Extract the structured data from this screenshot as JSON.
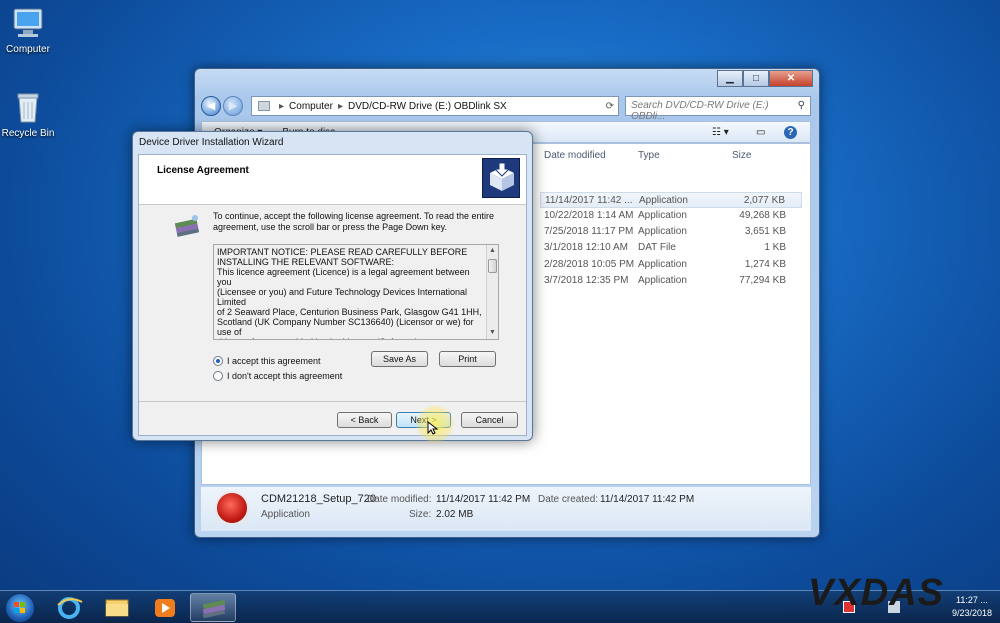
{
  "desktop": {
    "icons": [
      {
        "label": "Computer"
      },
      {
        "label": "Recycle Bin"
      }
    ]
  },
  "explorer": {
    "address": [
      "Computer",
      "DVD/CD-RW Drive (E:) OBDlink SX"
    ],
    "search_placeholder": "Search DVD/CD-RW Drive (E:) OBDli...",
    "toolbar": {
      "organize": "Organize ▾",
      "burn": "Burn to disc"
    },
    "columns": {
      "date": "Date modified",
      "type": "Type",
      "size": "Size"
    },
    "files": [
      {
        "date": "11/14/2017 11:42 ...",
        "type": "Application",
        "size": "2,077 KB"
      },
      {
        "date": "10/22/2018 1:14 AM",
        "type": "Application",
        "size": "49,268 KB"
      },
      {
        "date": "7/25/2018 11:17 PM",
        "type": "Application",
        "size": "3,651 KB"
      },
      {
        "date": "3/1/2018 12:10 AM",
        "type": "DAT File",
        "size": "1 KB"
      },
      {
        "date": "2/28/2018 10:05 PM",
        "type": "Application",
        "size": "1,274 KB"
      },
      {
        "date": "3/7/2018 12:35 PM",
        "type": "Application",
        "size": "77,294 KB"
      }
    ],
    "details": {
      "name": "CDM21218_Setup_720",
      "modified_label": "Date modified:",
      "modified": "11/14/2017 11:42 PM",
      "created_label": "Date created:",
      "created": "11/14/2017 11:42 PM",
      "kind": "Application",
      "size_label": "Size:",
      "size": "2.02 MB"
    }
  },
  "dialog": {
    "title": "Device Driver Installation Wizard",
    "heading": "License Agreement",
    "intro": "To continue, accept the following license agreement. To read the entire agreement, use the scroll bar or press the Page Down key.",
    "license_text": "IMPORTANT NOTICE: PLEASE READ CAREFULLY BEFORE\nINSTALLING THE RELEVANT SOFTWARE:\nThis licence agreement (Licence) is a legal agreement between you\n(Licensee or you) and Future Technology Devices International Limited\nof 2 Seaward Place, Centurion Business Park, Glasgow G41 1HH,\nScotland (UK Company Number SC136640) (Licensor or we) for use of\ndriver software provided by the Licensor(Software).\n\nBY INSTALLING OR USING THIS SOFTWARE YOU AGREE TO THE",
    "accept": "I accept this agreement",
    "decline": "I don't accept this agreement",
    "accepted": true,
    "save_as": "Save As",
    "print": "Print",
    "back": "< Back",
    "next": "Next >",
    "cancel": "Cancel"
  },
  "taskbar": {
    "clock_time": "11:27 ...",
    "clock_date": "9/23/2018"
  },
  "watermark": "VXDAS"
}
